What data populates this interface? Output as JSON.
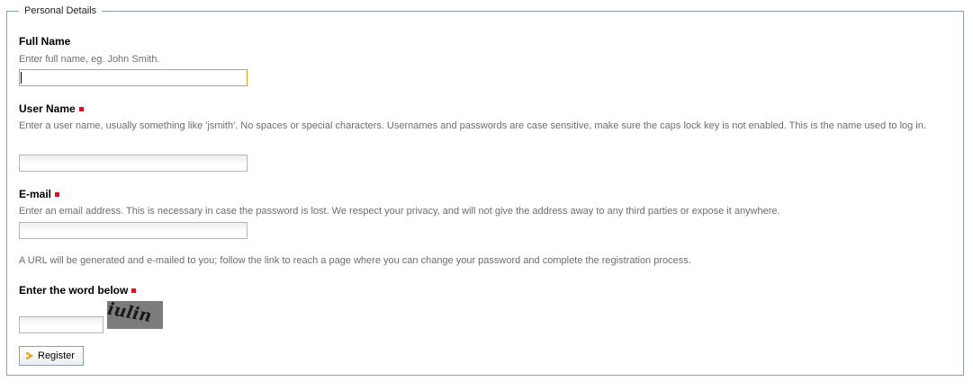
{
  "fieldset": {
    "legend": "Personal Details"
  },
  "full_name": {
    "label": "Full Name",
    "help": "Enter full name, eg. John Smith.",
    "value": "",
    "focused": true
  },
  "user_name": {
    "label": "User Name",
    "required": true,
    "help": "Enter a user name, usually something like 'jsmith'. No spaces or special characters. Usernames and passwords are case sensitive, make sure the caps lock key is not enabled. This is the name used to log in.",
    "value": ""
  },
  "email": {
    "label": "E-mail",
    "required": true,
    "help": "Enter an email address. This is necessary in case the password is lost. We respect your privacy, and will not give the address away to any third parties or expose it anywhere.",
    "value": ""
  },
  "password_note": "A URL will be generated and e-mailed to you; follow the link to reach a page where you can change your password and complete the registration process.",
  "captcha": {
    "label": "Enter the word below",
    "required": true,
    "value": "",
    "image_word": "iulin"
  },
  "register_button": {
    "label": "Register",
    "icon": "arrow-right-icon"
  },
  "colors": {
    "required_marker": "#e0101a",
    "focus_border": "#e0a12a",
    "fieldset_border": "#8ca0b4",
    "help_text": "#6d6d6d"
  }
}
